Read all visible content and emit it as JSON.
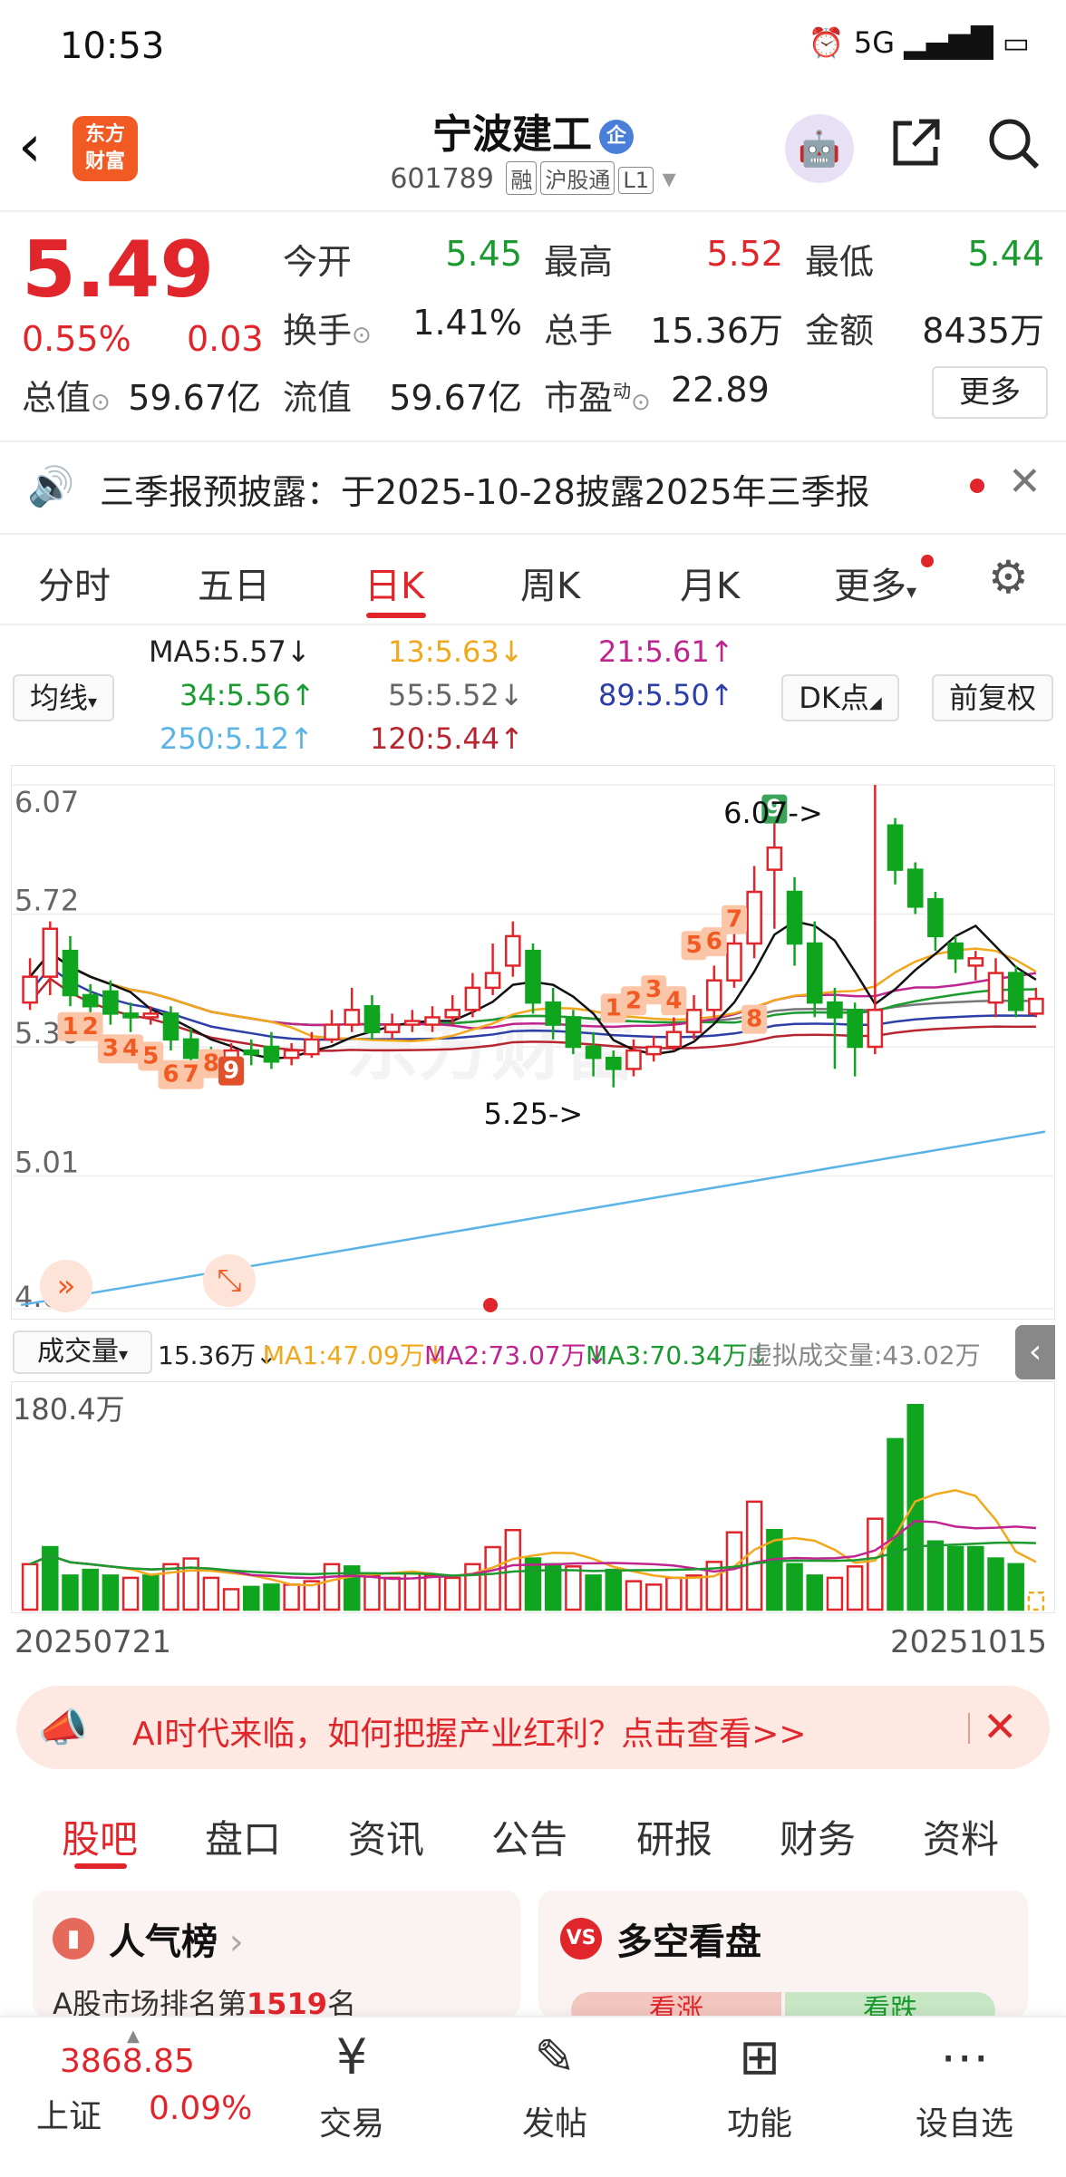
{
  "status_bar": {
    "time": "10:53",
    "icons": "⏰ 5G ▂▄▆█ ▭"
  },
  "header": {
    "back_icon": "chevron-left-icon",
    "logo_text": "东方\n财富",
    "title": "宁波建工",
    "title_badge": "企",
    "code": "601789",
    "tags": [
      "融",
      "沪股通",
      "L1"
    ]
  },
  "quote": {
    "price": "5.49",
    "pct": "0.55%",
    "chg": "0.03",
    "rows": [
      [
        {
          "label": "今开",
          "value": "5.45",
          "color": "green"
        },
        {
          "label": "最高",
          "value": "5.52",
          "color": "red"
        },
        {
          "label": "最低",
          "value": "5.44",
          "color": "green"
        }
      ],
      [
        {
          "label": "换手",
          "value": "1.41%",
          "color": "black"
        },
        {
          "label": "总手",
          "value": "15.36万",
          "color": "black"
        },
        {
          "label": "金额",
          "value": "8435万",
          "color": "black"
        }
      ]
    ],
    "total_label": "总值",
    "total_value": "59.67亿",
    "float_label": "流值",
    "float_value": "59.67亿",
    "pe_label": "市盈",
    "pe_sup": "动",
    "pe_value": "22.89",
    "more": "更多"
  },
  "notice": {
    "text": "三季报预披露：于2025-10-28披露2025年三季报"
  },
  "tabs": {
    "items": [
      "分时",
      "五日",
      "日K",
      "周K",
      "月K",
      "更多"
    ],
    "active": "日K"
  },
  "ma": {
    "selector": "均线",
    "dk": "DK点",
    "fq": "前复权",
    "items": [
      {
        "text": "MA5:5.57↓",
        "color": "#222222"
      },
      {
        "text": "13:5.63↓",
        "color": "#f2a81d"
      },
      {
        "text": "21:5.61↑",
        "color": "#c0248f"
      },
      {
        "text": "34:5.56↑",
        "color": "#1a9a2f"
      },
      {
        "text": "55:5.52↓",
        "color": "#666666"
      },
      {
        "text": "89:5.50↑",
        "color": "#2c3fa8"
      },
      {
        "text": "250:5.12↑",
        "color": "#5ab4e6"
      },
      {
        "text": "120:5.44↑",
        "color": "#b8252f"
      }
    ]
  },
  "chart_data": {
    "type": "candlestick",
    "y_ticks": [
      "6.07",
      "5.72",
      "5.36",
      "5.01",
      "4.65"
    ],
    "ylim": [
      4.65,
      6.07
    ],
    "annotations": [
      "6.07->",
      "5.25->"
    ],
    "dk_marks": [
      "1",
      "2",
      "3",
      "4",
      "5",
      "6",
      "7",
      "8",
      "9"
    ],
    "candles": [
      {
        "o": 5.48,
        "c": 5.55,
        "h": 5.6,
        "l": 5.46
      },
      {
        "o": 5.55,
        "c": 5.68,
        "h": 5.7,
        "l": 5.5
      },
      {
        "o": 5.62,
        "c": 5.5,
        "h": 5.66,
        "l": 5.47
      },
      {
        "o": 5.5,
        "c": 5.47,
        "h": 5.53,
        "l": 5.44
      },
      {
        "o": 5.51,
        "c": 5.45,
        "h": 5.54,
        "l": 5.42
      },
      {
        "o": 5.45,
        "c": 5.44,
        "h": 5.48,
        "l": 5.4
      },
      {
        "o": 5.44,
        "c": 5.45,
        "h": 5.47,
        "l": 5.42
      },
      {
        "o": 5.45,
        "c": 5.38,
        "h": 5.47,
        "l": 5.35
      },
      {
        "o": 5.38,
        "c": 5.33,
        "h": 5.41,
        "l": 5.3
      },
      {
        "o": 5.34,
        "c": 5.3,
        "h": 5.36,
        "l": 5.28
      },
      {
        "o": 5.3,
        "c": 5.35,
        "h": 5.37,
        "l": 5.27
      },
      {
        "o": 5.35,
        "c": 5.34,
        "h": 5.38,
        "l": 5.31
      },
      {
        "o": 5.36,
        "c": 5.32,
        "h": 5.4,
        "l": 5.3
      },
      {
        "o": 5.33,
        "c": 5.35,
        "h": 5.37,
        "l": 5.31
      },
      {
        "o": 5.34,
        "c": 5.38,
        "h": 5.4,
        "l": 5.33
      },
      {
        "o": 5.38,
        "c": 5.42,
        "h": 5.46,
        "l": 5.37
      },
      {
        "o": 5.42,
        "c": 5.46,
        "h": 5.52,
        "l": 5.4
      },
      {
        "o": 5.47,
        "c": 5.4,
        "h": 5.5,
        "l": 5.38
      },
      {
        "o": 5.4,
        "c": 5.42,
        "h": 5.45,
        "l": 5.38
      },
      {
        "o": 5.42,
        "c": 5.43,
        "h": 5.46,
        "l": 5.4
      },
      {
        "o": 5.42,
        "c": 5.44,
        "h": 5.47,
        "l": 5.4
      },
      {
        "o": 5.44,
        "c": 5.46,
        "h": 5.5,
        "l": 5.42
      },
      {
        "o": 5.46,
        "c": 5.52,
        "h": 5.56,
        "l": 5.44
      },
      {
        "o": 5.52,
        "c": 5.56,
        "h": 5.64,
        "l": 5.5
      },
      {
        "o": 5.58,
        "c": 5.66,
        "h": 5.7,
        "l": 5.55
      },
      {
        "o": 5.62,
        "c": 5.48,
        "h": 5.64,
        "l": 5.45
      },
      {
        "o": 5.48,
        "c": 5.42,
        "h": 5.52,
        "l": 5.38
      },
      {
        "o": 5.44,
        "c": 5.36,
        "h": 5.46,
        "l": 5.34
      },
      {
        "o": 5.36,
        "c": 5.33,
        "h": 5.4,
        "l": 5.28
      },
      {
        "o": 5.33,
        "c": 5.3,
        "h": 5.35,
        "l": 5.25
      },
      {
        "o": 5.3,
        "c": 5.35,
        "h": 5.38,
        "l": 5.28
      },
      {
        "o": 5.34,
        "c": 5.36,
        "h": 5.39,
        "l": 5.32
      },
      {
        "o": 5.36,
        "c": 5.4,
        "h": 5.44,
        "l": 5.35
      },
      {
        "o": 5.4,
        "c": 5.46,
        "h": 5.5,
        "l": 5.38
      },
      {
        "o": 5.46,
        "c": 5.54,
        "h": 5.58,
        "l": 5.44
      },
      {
        "o": 5.54,
        "c": 5.64,
        "h": 5.7,
        "l": 5.52
      },
      {
        "o": 5.64,
        "c": 5.78,
        "h": 5.85,
        "l": 5.6
      },
      {
        "o": 5.84,
        "c": 5.9,
        "h": 6.0,
        "l": 5.68
      },
      {
        "o": 5.78,
        "c": 5.64,
        "h": 5.82,
        "l": 5.58
      },
      {
        "o": 5.64,
        "c": 5.48,
        "h": 5.7,
        "l": 5.44
      },
      {
        "o": 5.48,
        "c": 5.44,
        "h": 5.52,
        "l": 5.3
      },
      {
        "o": 5.46,
        "c": 5.36,
        "h": 5.48,
        "l": 5.28
      },
      {
        "o": 5.36,
        "c": 5.46,
        "h": 6.07,
        "l": 5.34
      },
      {
        "o": 5.96,
        "c": 5.84,
        "h": 5.98,
        "l": 5.8
      },
      {
        "o": 5.84,
        "c": 5.74,
        "h": 5.86,
        "l": 5.72
      },
      {
        "o": 5.76,
        "c": 5.66,
        "h": 5.78,
        "l": 5.62
      },
      {
        "o": 5.64,
        "c": 5.6,
        "h": 5.66,
        "l": 5.56
      },
      {
        "o": 5.58,
        "c": 5.6,
        "h": 5.62,
        "l": 5.54
      },
      {
        "o": 5.48,
        "c": 5.56,
        "h": 5.6,
        "l": 5.44
      },
      {
        "o": 5.56,
        "c": 5.46,
        "h": 5.58,
        "l": 5.44
      },
      {
        "o": 5.45,
        "c": 5.49,
        "h": 5.52,
        "l": 5.44
      }
    ],
    "ma250": {
      "start": 4.66,
      "end": 5.13
    }
  },
  "volume": {
    "selector": "成交量",
    "vol": "15.36万↓",
    "ma1": "MA1:47.09万↓",
    "ma2": "MA2:73.07万↓",
    "ma3": "MA3:70.34万↓",
    "virtual": "虚拟成交量:43.02万",
    "max_label": "180.4万",
    "bars": [
      40,
      55,
      30,
      35,
      30,
      28,
      30,
      40,
      45,
      28,
      18,
      20,
      22,
      22,
      25,
      40,
      38,
      30,
      28,
      32,
      30,
      28,
      40,
      55,
      70,
      45,
      40,
      38,
      30,
      35,
      25,
      22,
      28,
      30,
      42,
      68,
      95,
      70,
      40,
      30,
      28,
      38,
      80,
      150,
      180,
      60,
      55,
      55,
      45,
      40,
      15
    ],
    "colors": [
      "r",
      "g",
      "g",
      "g",
      "g",
      "r",
      "g",
      "r",
      "r",
      "r",
      "r",
      "g",
      "g",
      "r",
      "r",
      "r",
      "g",
      "r",
      "r",
      "r",
      "r",
      "r",
      "r",
      "r",
      "r",
      "g",
      "g",
      "r",
      "g",
      "g",
      "r",
      "r",
      "r",
      "r",
      "r",
      "r",
      "r",
      "g",
      "g",
      "g",
      "r",
      "r",
      "r",
      "g",
      "g",
      "g",
      "g",
      "g",
      "g",
      "g",
      "r"
    ]
  },
  "dates": {
    "start": "20250721",
    "end": "20251015"
  },
  "ad": {
    "text": "AI时代来临，如何把握产业红利？点击查看>>"
  },
  "bottom_tabs": {
    "items": [
      "股吧",
      "盘口",
      "资讯",
      "公告",
      "研报",
      "财务",
      "资料"
    ],
    "active": "股吧"
  },
  "cards": {
    "left_title": "人气榜",
    "left_sub_prefix": "A股市场排名第",
    "left_rank": "1519",
    "left_sub_suffix": "名",
    "right_title": "多空看盘",
    "right_left": "看涨",
    "right_right": "看跌"
  },
  "nav": {
    "index_value": "3868.85",
    "index_name": "上证",
    "index_pct": "0.09%",
    "items": [
      {
        "label": "交易",
        "icon": "¥"
      },
      {
        "label": "发帖",
        "icon": "✎"
      },
      {
        "label": "功能",
        "icon": "⊞"
      },
      {
        "label": "设自选",
        "icon": "⋯"
      }
    ]
  }
}
